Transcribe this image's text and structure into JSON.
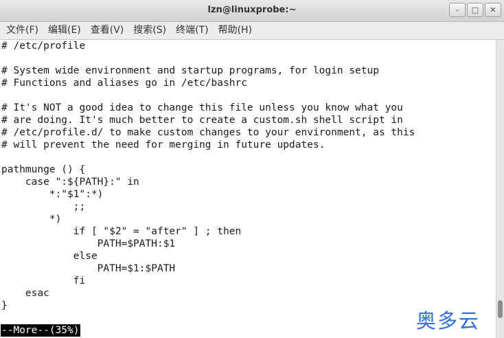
{
  "window": {
    "title": "lzn@linuxprobe:~",
    "controls": {
      "minimize": "–",
      "maximize": "□",
      "close": "✕"
    }
  },
  "menu": [
    "文件(F)",
    "编辑(E)",
    "查看(V)",
    "搜索(S)",
    "终端(T)",
    "帮助(H)"
  ],
  "terminal": {
    "lines": [
      "# /etc/profile",
      "",
      "# System wide environment and startup programs, for login setup",
      "# Functions and aliases go in /etc/bashrc",
      "",
      "# It's NOT a good idea to change this file unless you know what you",
      "# are doing. It's much better to create a custom.sh shell script in",
      "# /etc/profile.d/ to make custom changes to your environment, as this",
      "# will prevent the need for merging in future updates.",
      "",
      "pathmunge () {",
      "    case \":${PATH}:\" in",
      "        *:\"$1\":*)",
      "            ;;",
      "        *)",
      "            if [ \"$2\" = \"after\" ] ; then",
      "                PATH=$PATH:$1",
      "            else",
      "                PATH=$1:$PATH",
      "            fi",
      "    esac",
      "}"
    ],
    "pager_status": "--More--(35%)",
    "scroll_position": 0.93,
    "scroll_visible_fraction": 0.06
  },
  "watermark": "奥多云",
  "colors": {
    "watermark": "#2f6fd8",
    "pager_bg": "#000000",
    "pager_fg": "#ffffff"
  }
}
